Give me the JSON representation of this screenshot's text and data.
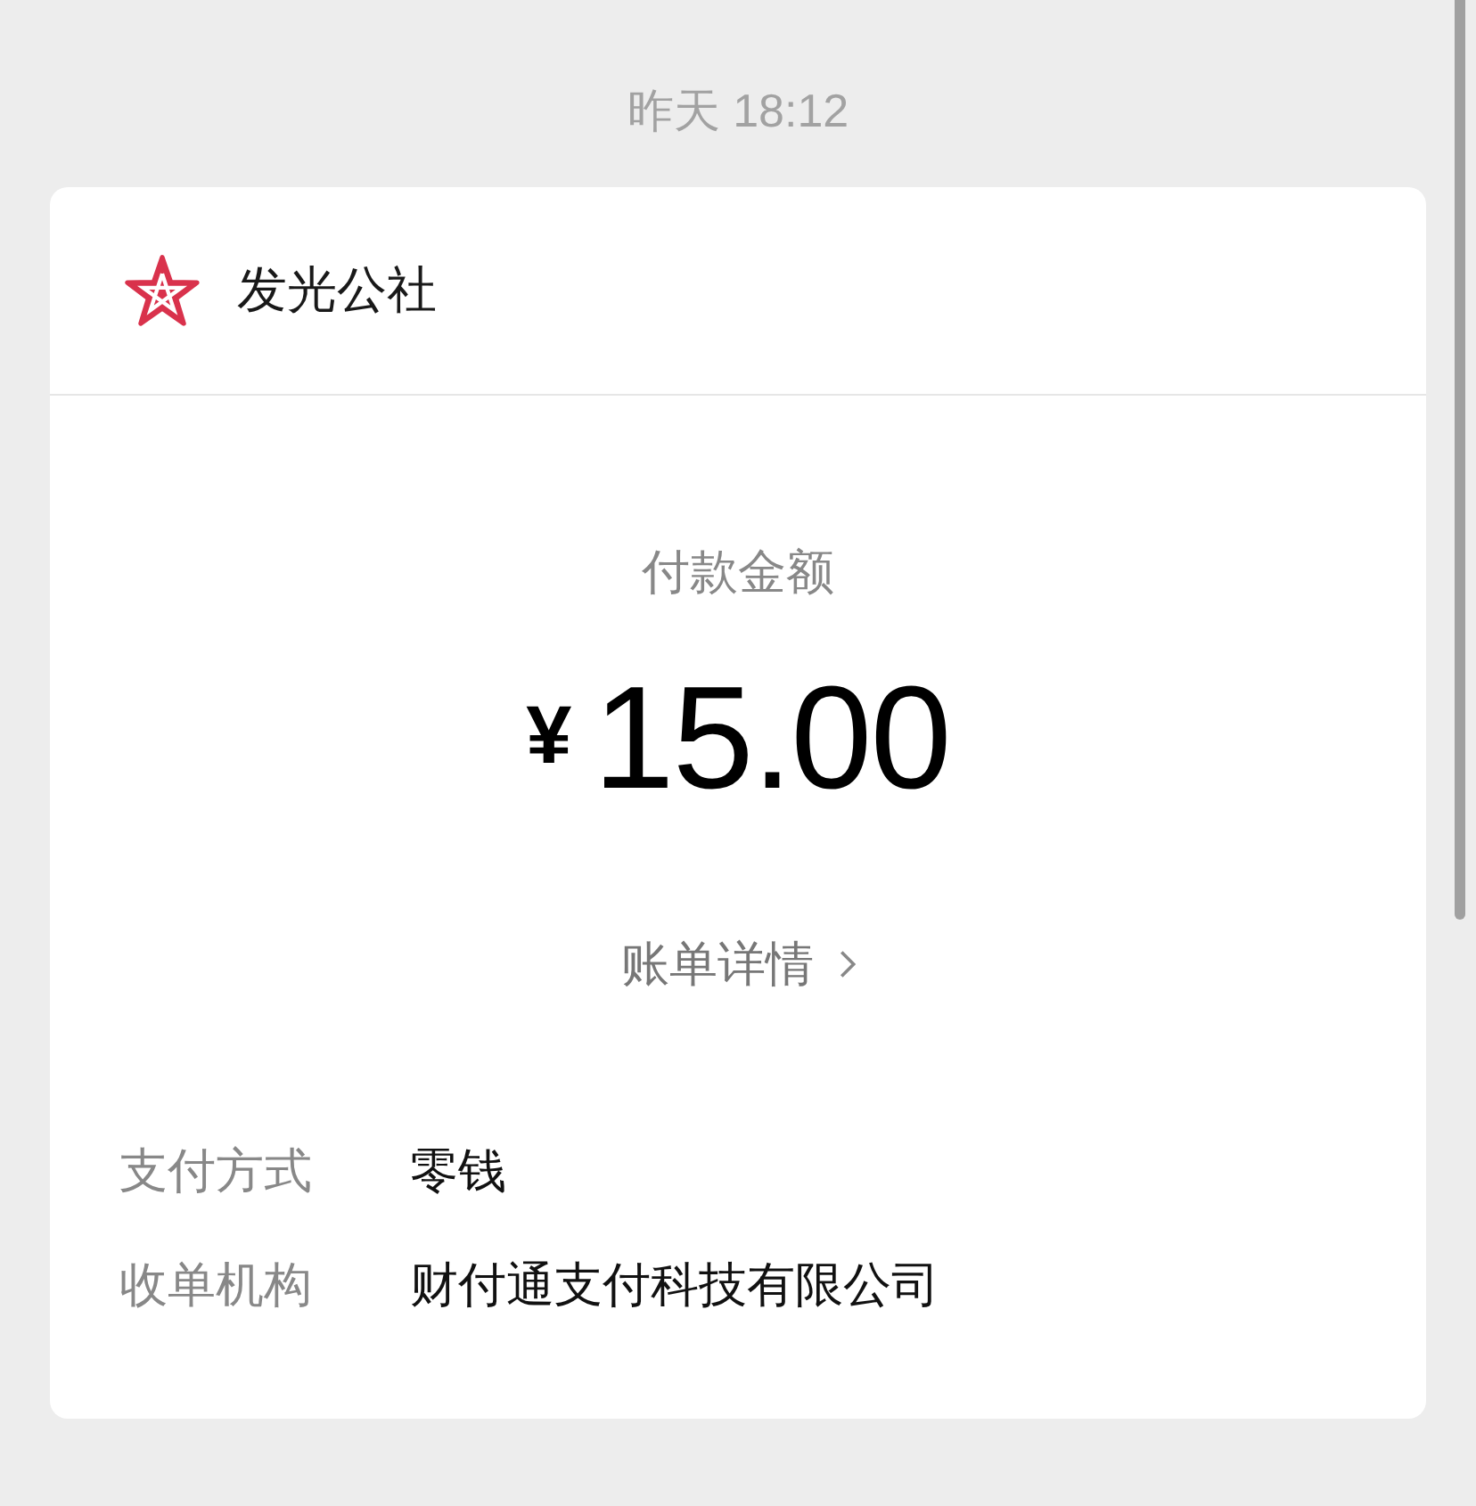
{
  "timestamp": "昨天 18:12",
  "card": {
    "merchant": {
      "name": "发光公社"
    },
    "amount_label": "付款金额",
    "currency": "¥",
    "amount": "15.00",
    "details_link": {
      "label": "账单详情"
    },
    "rows": [
      {
        "label": "支付方式",
        "value": "零钱"
      },
      {
        "label": "收单机构",
        "value": "财付通支付科技有限公司"
      }
    ]
  }
}
